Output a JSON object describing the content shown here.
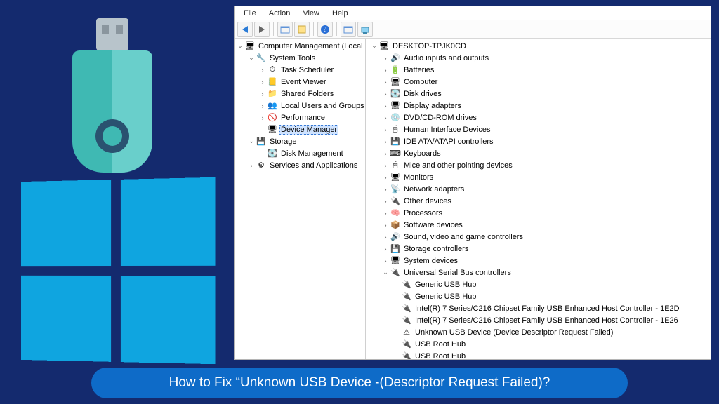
{
  "menu": {
    "file": "File",
    "action": "Action",
    "view": "View",
    "help": "Help"
  },
  "toolbar": {
    "back": "back-icon",
    "fwd": "forward-icon",
    "up": "up-icon",
    "show": "show-hide-icon",
    "help": "help-icon",
    "props": "properties-icon",
    "scan": "scan-icon"
  },
  "leftTree": [
    {
      "d": 0,
      "t": "v",
      "ic": "🖥",
      "label": "Computer Management (Local"
    },
    {
      "d": 1,
      "t": "v",
      "ic": "🔧",
      "label": "System Tools"
    },
    {
      "d": 2,
      "t": ">",
      "ic": "⏱",
      "label": "Task Scheduler"
    },
    {
      "d": 2,
      "t": ">",
      "ic": "📒",
      "label": "Event Viewer"
    },
    {
      "d": 2,
      "t": ">",
      "ic": "📁",
      "label": "Shared Folders"
    },
    {
      "d": 2,
      "t": ">",
      "ic": "👥",
      "label": "Local Users and Groups"
    },
    {
      "d": 2,
      "t": ">",
      "ic": "🚫",
      "label": "Performance"
    },
    {
      "d": 2,
      "t": "",
      "ic": "🖥",
      "label": "Device Manager",
      "sel": true
    },
    {
      "d": 1,
      "t": "v",
      "ic": "💾",
      "label": "Storage"
    },
    {
      "d": 2,
      "t": "",
      "ic": "💽",
      "label": "Disk Management"
    },
    {
      "d": 1,
      "t": ">",
      "ic": "⚙",
      "label": "Services and Applications"
    }
  ],
  "rightTree": [
    {
      "d": 0,
      "t": "v",
      "ic": "🖥",
      "label": "DESKTOP-TPJK0CD"
    },
    {
      "d": 1,
      "t": ">",
      "ic": "🔊",
      "label": "Audio inputs and outputs"
    },
    {
      "d": 1,
      "t": ">",
      "ic": "🔋",
      "label": "Batteries"
    },
    {
      "d": 1,
      "t": ">",
      "ic": "🖥",
      "label": "Computer"
    },
    {
      "d": 1,
      "t": ">",
      "ic": "💽",
      "label": "Disk drives"
    },
    {
      "d": 1,
      "t": ">",
      "ic": "🖥",
      "label": "Display adapters"
    },
    {
      "d": 1,
      "t": ">",
      "ic": "💿",
      "label": "DVD/CD-ROM drives"
    },
    {
      "d": 1,
      "t": ">",
      "ic": "🖱",
      "label": "Human Interface Devices"
    },
    {
      "d": 1,
      "t": ">",
      "ic": "💾",
      "label": "IDE ATA/ATAPI controllers"
    },
    {
      "d": 1,
      "t": ">",
      "ic": "⌨",
      "label": "Keyboards"
    },
    {
      "d": 1,
      "t": ">",
      "ic": "🖱",
      "label": "Mice and other pointing devices"
    },
    {
      "d": 1,
      "t": ">",
      "ic": "🖥",
      "label": "Monitors"
    },
    {
      "d": 1,
      "t": ">",
      "ic": "📡",
      "label": "Network adapters"
    },
    {
      "d": 1,
      "t": ">",
      "ic": "🔌",
      "label": "Other devices"
    },
    {
      "d": 1,
      "t": ">",
      "ic": "🧠",
      "label": "Processors"
    },
    {
      "d": 1,
      "t": ">",
      "ic": "📦",
      "label": "Software devices"
    },
    {
      "d": 1,
      "t": ">",
      "ic": "🔊",
      "label": "Sound, video and game controllers"
    },
    {
      "d": 1,
      "t": ">",
      "ic": "💾",
      "label": "Storage controllers"
    },
    {
      "d": 1,
      "t": ">",
      "ic": "🖥",
      "label": "System devices"
    },
    {
      "d": 1,
      "t": "v",
      "ic": "🔌",
      "label": "Universal Serial Bus controllers"
    },
    {
      "d": 2,
      "t": "",
      "ic": "🔌",
      "label": "Generic USB Hub"
    },
    {
      "d": 2,
      "t": "",
      "ic": "🔌",
      "label": "Generic USB Hub"
    },
    {
      "d": 2,
      "t": "",
      "ic": "🔌",
      "label": "Intel(R) 7 Series/C216 Chipset Family USB Enhanced Host Controller - 1E2D"
    },
    {
      "d": 2,
      "t": "",
      "ic": "🔌",
      "label": "Intel(R) 7 Series/C216 Chipset Family USB Enhanced Host Controller - 1E26"
    },
    {
      "d": 2,
      "t": "",
      "ic": "⚠",
      "label": "Unknown USB Device (Device Descriptor Request Failed)",
      "sel2": true
    },
    {
      "d": 2,
      "t": "",
      "ic": "🔌",
      "label": "USB Root Hub"
    },
    {
      "d": 2,
      "t": "",
      "ic": "🔌",
      "label": "USB Root Hub"
    }
  ],
  "caption": "How to Fix “Unknown USB Device -(Descriptor Request Failed)?",
  "colors": {
    "bg": "#142a6e",
    "accent": "#0e6bc8",
    "win": "#0fa5e0"
  }
}
